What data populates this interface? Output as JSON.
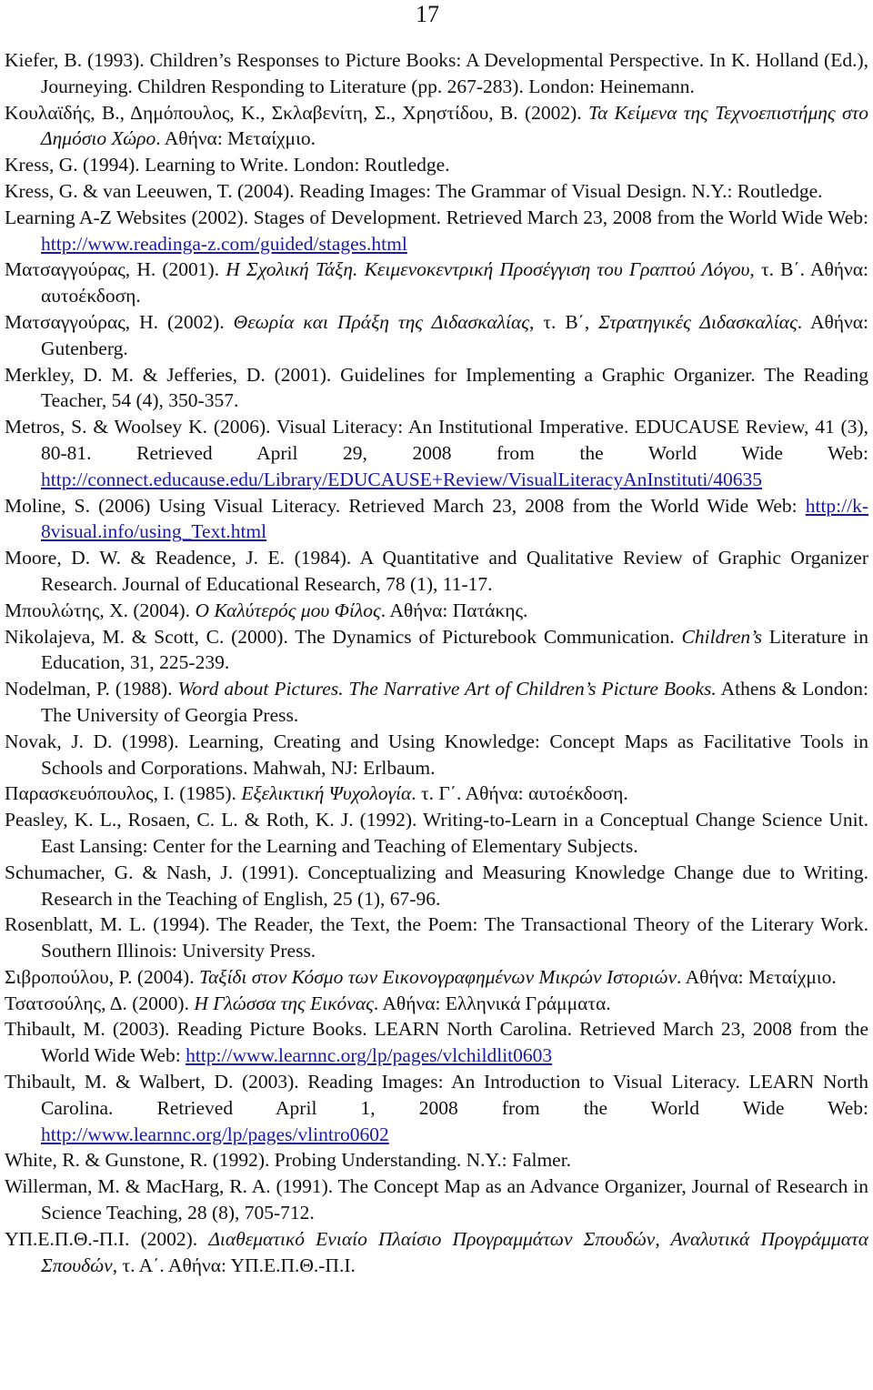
{
  "page": {
    "number": "17"
  },
  "colors": {
    "text": "#111111",
    "link": "#1a1aa6",
    "background": "#ffffff"
  },
  "references": [
    {
      "segments": [
        {
          "text": "Kiefer, B. (1993). Children’s Responses to Picture Books: A Developmental Perspective. In K. Holland (Ed.), Journeying. Children Responding to Literature (pp. 267-283). London: Heinemann.",
          "style": "normal"
        }
      ]
    },
    {
      "segments": [
        {
          "text": "Κουλαϊδής, Β., Δημόπουλος, Κ., Σκλαβενίτη, Σ., Χρηστίδου, Β. (2002). ",
          "style": "normal"
        },
        {
          "text": "Τα Κείμενα της Τεχνοεπιστήμης στο Δημόσιο Χώρο",
          "style": "italic"
        },
        {
          "text": ". Αθήνα: Μεταίχμιο.",
          "style": "normal"
        }
      ]
    },
    {
      "segments": [
        {
          "text": "Kress, G. (1994). Learning to Write. London: Routledge.",
          "style": "normal"
        }
      ]
    },
    {
      "segments": [
        {
          "text": "Kress, G. & van Leeuwen, T. (2004). Reading Images: The Grammar of Visual Design. N.Y.: Routledge.",
          "style": "normal"
        }
      ]
    },
    {
      "segments": [
        {
          "text": "Learning A-Z Websites (2002). Stages of Development. Retrieved March 23, 2008 from the World Wide Web: ",
          "style": "normal"
        },
        {
          "text": "http://www.readinga-z.com/guided/stages.html",
          "style": "link"
        }
      ]
    },
    {
      "segments": [
        {
          "text": "Ματσαγγούρας, Η. (2001). ",
          "style": "normal"
        },
        {
          "text": "Η Σχολική Τάξη. Κειμενοκεντρική Προσέγγιση του Γραπτού Λόγου,",
          "style": "italic"
        },
        {
          "text": " τ. Β΄. Αθήνα: αυτοέκδοση.",
          "style": "normal"
        }
      ]
    },
    {
      "segments": [
        {
          "text": "Ματσαγγούρας, Η. (2002). ",
          "style": "normal"
        },
        {
          "text": "Θεωρία και Πράξη της Διδασκαλίας",
          "style": "italic"
        },
        {
          "text": ", τ. Β΄, ",
          "style": "normal"
        },
        {
          "text": "Στρατηγικές Διδασκαλίας",
          "style": "italic"
        },
        {
          "text": ". Αθήνα: Gutenberg.",
          "style": "normal"
        }
      ]
    },
    {
      "segments": [
        {
          "text": "Merkley, D. M. & Jefferies, D. (2001). Guidelines for Implementing a Graphic Organizer. The Reading Teacher, 54 (4), 350-357.",
          "style": "normal"
        }
      ]
    },
    {
      "segments": [
        {
          "text": "Metros, S. & Woolsey K. (2006). Visual Literacy: An Institutional Imperative. EDUCAUSE Review, 41 (3), 80-81. Retrieved April 29, 2008 from the World Wide Web: ",
          "style": "normal"
        },
        {
          "text": "http://connect.educause.edu/Library/EDUCAUSE+Review/VisualLiteracyAnInstituti/40635",
          "style": "link"
        }
      ]
    },
    {
      "segments": [
        {
          "text": "Moline, S. (2006) Using Visual Literacy. Retrieved March 23, 2008 from the World Wide Web: ",
          "style": "normal"
        },
        {
          "text": "http://k-8visual.info/using_Text.html",
          "style": "link"
        }
      ]
    },
    {
      "segments": [
        {
          "text": "Moore, D. W. & Readence, J. E. (1984). A Quantitative and Qualitative Review of  Graphic Organizer Research. Journal of Educational Research, 78 (1), 11-17.",
          "style": "normal"
        }
      ]
    },
    {
      "segments": [
        {
          "text": "Μπουλώτης, Χ. (2004). ",
          "style": "normal"
        },
        {
          "text": "Ο Καλύτερός μου Φίλος",
          "style": "italic"
        },
        {
          "text": ". Αθήνα: Πατάκης.",
          "style": "normal"
        }
      ]
    },
    {
      "segments": [
        {
          "text": "Nikolajeva, M. & Scott, C. (2000). The Dynamics of Picturebook Communication. ",
          "style": "normal"
        },
        {
          "text": "Children’s",
          "style": "italic"
        },
        {
          "text": " Literature in Education, 31, 225-239.",
          "style": "normal"
        }
      ]
    },
    {
      "segments": [
        {
          "text": "Nodelman, P. (1988). ",
          "style": "normal"
        },
        {
          "text": "Word about Pictures. The Narrative Art of Children’s Picture Books.",
          "style": "italic"
        },
        {
          "text": " Athens & London: The University of Georgia Press.",
          "style": "normal"
        }
      ]
    },
    {
      "segments": [
        {
          "text": "Novak, J. D. (1998). Learning, Creating and Using Knowledge: Concept Maps as Facilitative Tools in Schools and Corporations. Mahwah, NJ: Erlbaum.",
          "style": "normal"
        }
      ]
    },
    {
      "segments": [
        {
          "text": "Παρασκευόπουλος, Ι. (1985). ",
          "style": "normal"
        },
        {
          "text": "Εξελικτική Ψυχολογία",
          "style": "italic"
        },
        {
          "text": ". τ. Γ΄. Αθήνα: αυτοέκδοση.",
          "style": "normal"
        }
      ]
    },
    {
      "segments": [
        {
          "text": "Peasley, K. L., Rosaen, C. L. & Roth, K. J. (1992). Writing-to-Learn in a Conceptual Change Science Unit. East Lansing: Center for the Learning and Teaching of Elementary Subjects.",
          "style": "normal"
        }
      ]
    },
    {
      "segments": [
        {
          "text": "Schumacher, G. & Nash, J. (1991). Conceptualizing and Measuring Knowledge Change due to Writing. Research in the Teaching of English, 25 (1), 67-96.",
          "style": "normal"
        }
      ]
    },
    {
      "segments": [
        {
          "text": "Rosenblatt, M. L. (1994). The Reader, the Text, the Poem: The Transactional Theory of the Literary Work. Southern Illinois: University Press.",
          "style": "normal"
        }
      ]
    },
    {
      "segments": [
        {
          "text": "Σιβροπούλου, Ρ. (2004). ",
          "style": "normal"
        },
        {
          "text": "Ταξίδι στον Κόσμο των Εικονογραφημένων Μικρών Ιστοριών",
          "style": "italic"
        },
        {
          "text": ". Αθήνα: Μεταίχμιο.",
          "style": "normal"
        }
      ]
    },
    {
      "segments": [
        {
          "text": "Τσατσούλης, Δ. (2000). ",
          "style": "normal"
        },
        {
          "text": "Η Γλώσσα της Εικόνας",
          "style": "italic"
        },
        {
          "text": ". Αθήνα: Ελληνικά Γράμματα.",
          "style": "normal"
        }
      ]
    },
    {
      "segments": [
        {
          "text": "Thibault, M. (2003). Reading Picture Books. LEARN North Carolina. Retrieved March 23, 2008 from the World Wide Web: ",
          "style": "normal"
        },
        {
          "text": "http://www.learnnc.org/lp/pages/vlchildlit0603",
          "style": "link"
        }
      ]
    },
    {
      "segments": [
        {
          "text": "Thibault, M. & Walbert, D. (2003). Reading Images: An Introduction to Visual Literacy. LEARN North Carolina. Retrieved April 1, 2008 from the World Wide Web: ",
          "style": "normal"
        },
        {
          "text": "http://www.learnnc.org/lp/pages/vlintro0602",
          "style": "link"
        }
      ]
    },
    {
      "segments": [
        {
          "text": "White, R. & Gunstone, R. (1992). Probing Understanding. N.Y.: Falmer.",
          "style": "normal"
        }
      ]
    },
    {
      "segments": [
        {
          "text": "Willerman, M. & MacHarg, R. A. (1991). The Concept Map as an Advance Organizer, Journal of Research in Science Teaching, 28 (8), 705-712.",
          "style": "normal"
        }
      ]
    },
    {
      "segments": [
        {
          "text": "ΥΠ.Ε.Π.Θ.-Π.Ι. (2002). ",
          "style": "normal"
        },
        {
          "text": "Διαθεματικό Ενιαίο Πλαίσιο Προγραμμάτων Σπουδών, Αναλυτικά Προγράμματα Σπουδών",
          "style": "italic"
        },
        {
          "text": ", τ. Α΄. Αθήνα: ΥΠ.Ε.Π.Θ.-Π.Ι.",
          "style": "normal"
        }
      ]
    }
  ]
}
